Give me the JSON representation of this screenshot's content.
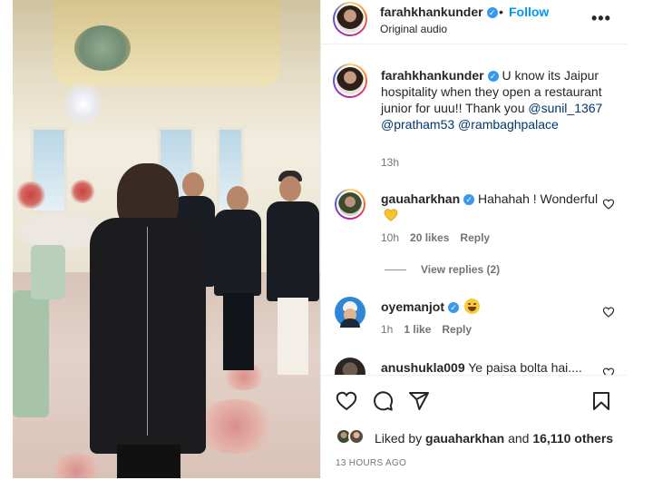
{
  "header": {
    "username": "farahkhankunder",
    "separator": "•",
    "follow_label": "Follow",
    "audio": "Original audio",
    "more_label": "•••"
  },
  "caption": {
    "username": "farahkhankunder",
    "text_1": " U know its Jaipur hospitality when they open a restaurant junior for uuu!! Thank you ",
    "mentions": [
      "@sunil_1367",
      "@pratham53",
      "@rambaghpalace"
    ],
    "time": "13h"
  },
  "comments": [
    {
      "username": "gauaharkhan",
      "text": " Hahahah ! Wonderful",
      "time": "10h",
      "likes": "20 likes",
      "reply_label": "Reply",
      "view_replies": "View replies (2)",
      "emoji": "yellow-heart"
    },
    {
      "username": "oyemanjot",
      "text": "",
      "time": "1h",
      "likes": "1 like",
      "reply_label": "Reply",
      "emoji": "laughing-face"
    },
    {
      "username": "anushukla009",
      "text": " Ye paisa bolta hai...."
    }
  ],
  "actions": {
    "liked_prefix": "Liked by ",
    "liked_user": "gauaharkhan",
    "liked_mid": " and ",
    "liked_count": "16,110 others",
    "timestamp": "13 HOURS AGO"
  },
  "colors": {
    "accent": "#0095f6",
    "verified": "#3897f0",
    "muted": "#737373"
  }
}
